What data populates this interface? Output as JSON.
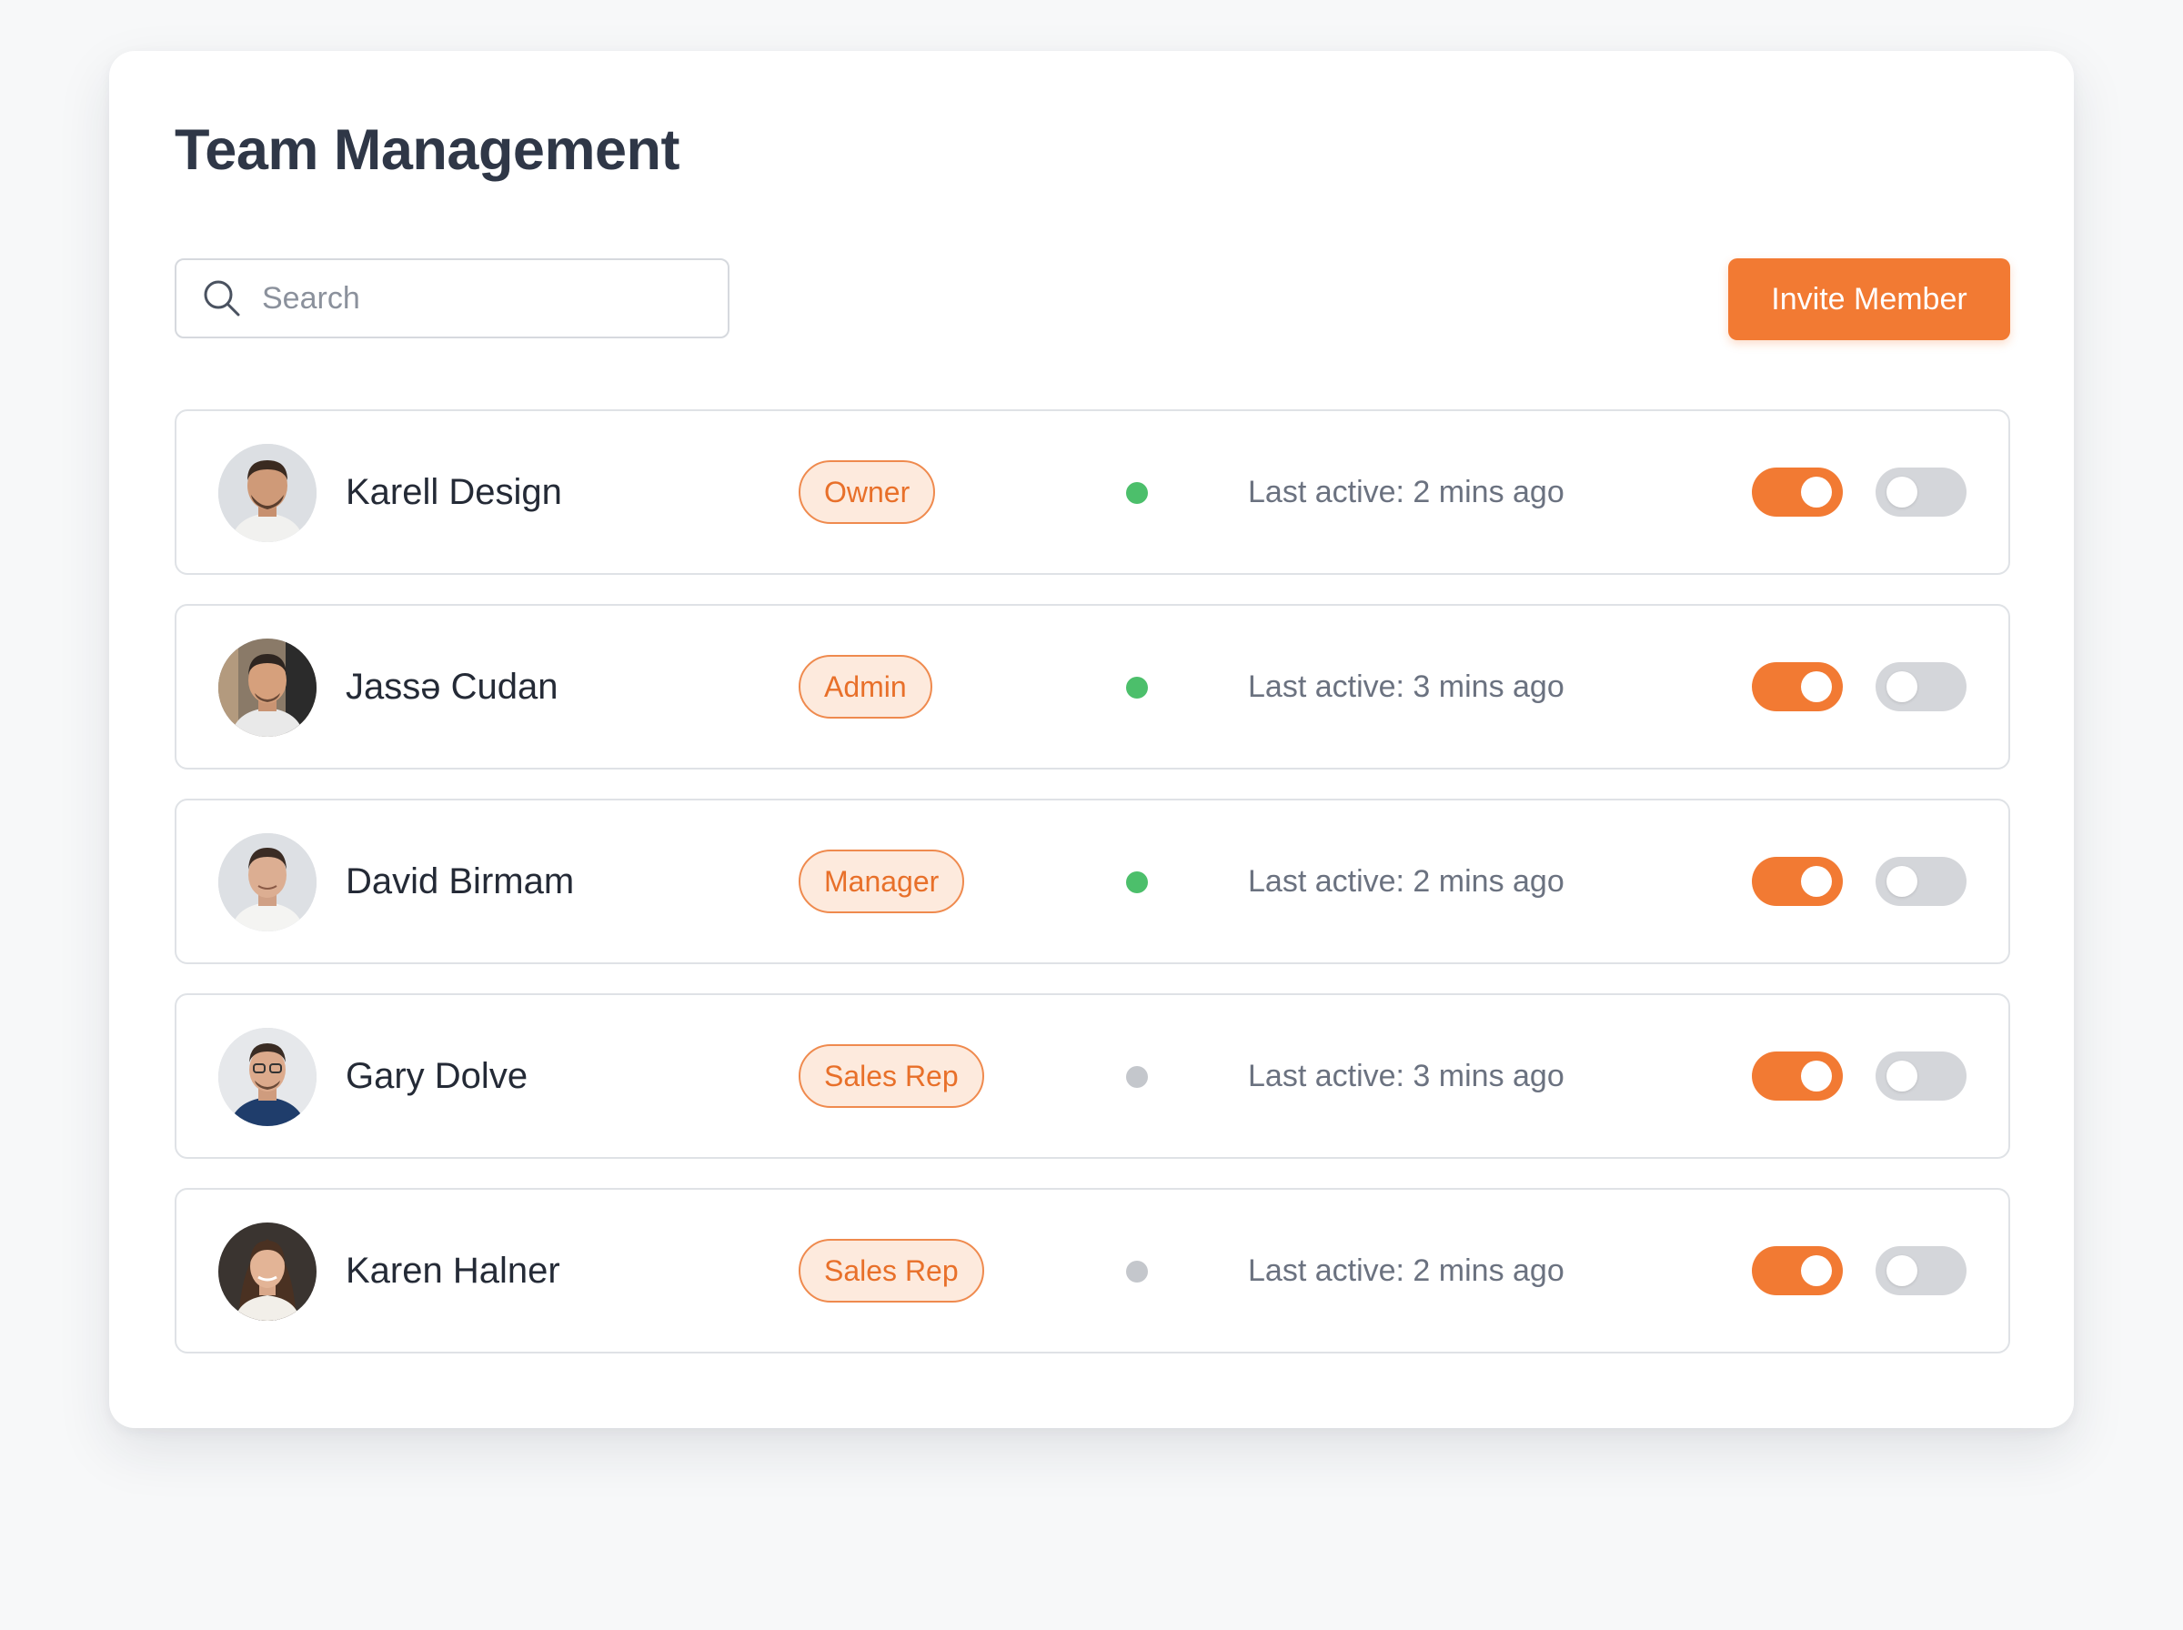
{
  "page": {
    "title": "Team Management"
  },
  "toolbar": {
    "search_placeholder": "Search",
    "search_value": "",
    "invite_label": "Invite Member"
  },
  "colors": {
    "accent": "#f27a33",
    "online": "#4cbf6b",
    "offline": "#c4c7cc"
  },
  "members": [
    {
      "name": "Karell Design",
      "role": "Owner",
      "status": "online",
      "last_active": "Last active: 2 mins ago",
      "toggle_primary_on": true,
      "toggle_secondary_on": false
    },
    {
      "name": "Jassə Cudan",
      "role": "Admin",
      "status": "online",
      "last_active": "Last active: 3 mins ago",
      "toggle_primary_on": true,
      "toggle_secondary_on": false
    },
    {
      "name": "David Birmam",
      "role": "Manager",
      "status": "online",
      "last_active": "Last active: 2 mins ago",
      "toggle_primary_on": true,
      "toggle_secondary_on": false
    },
    {
      "name": "Gary Dolve",
      "role": "Sales Rep",
      "status": "offline",
      "last_active": "Last active: 3 mins ago",
      "toggle_primary_on": true,
      "toggle_secondary_on": false
    },
    {
      "name": "Karen Halner",
      "role": "Sales Rep",
      "status": "offline",
      "last_active": "Last active: 2 mins ago",
      "toggle_primary_on": true,
      "toggle_secondary_on": false
    }
  ]
}
